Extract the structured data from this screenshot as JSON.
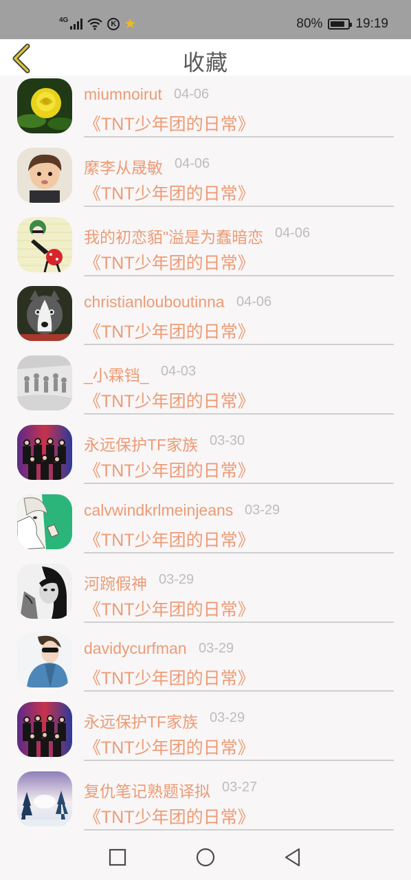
{
  "status_bar": {
    "network_tag": "4G",
    "battery_percent": "80%",
    "battery_level": 0.8,
    "time": "19:19",
    "icons": [
      "signal-icon",
      "wifi-icon",
      "k-app-icon",
      "star-app-icon",
      "battery-icon"
    ]
  },
  "header": {
    "title": "收藏",
    "back_icon": "chevron-left-icon",
    "accent_color": "#d9c23a"
  },
  "items": [
    {
      "name": "miumnoirut",
      "date": "04-06",
      "title": "《TNT少年团的日常》",
      "avatar": "yellow-rose"
    },
    {
      "name": "縻李从晟敏",
      "date": "04-06",
      "title": "《TNT少年团的日常》",
      "avatar": "child-photo"
    },
    {
      "name": "我的初恋貊\"溢是为蠢暗恋",
      "date": "04-06",
      "title": "《TNT少年团的日常》",
      "avatar": "cartoon-girl"
    },
    {
      "name": "christianlouboutinna",
      "date": "04-06",
      "title": "《TNT少年团的日常》",
      "avatar": "husky-dog"
    },
    {
      "name": "_小霖铛_",
      "date": "04-03",
      "title": "《TNT少年团的日常》",
      "avatar": "group-sketch"
    },
    {
      "name": "永远保护TF家族",
      "date": "03-30",
      "title": "《TNT少年团的日常》",
      "avatar": "group-photo"
    },
    {
      "name": "calvwindkrlmeinjeans",
      "date": "03-29",
      "title": "《TNT少年团的日常》",
      "avatar": "anime-girl"
    },
    {
      "name": "河踠假神",
      "date": "03-29",
      "title": "《TNT少年团的日常》",
      "avatar": "bw-portrait"
    },
    {
      "name": "davidycurfman",
      "date": "03-29",
      "title": "《TNT少年团的日常》",
      "avatar": "sunglasses-boy"
    },
    {
      "name": "永远保护TF家族",
      "date": "03-29",
      "title": "《TNT少年团的日常》",
      "avatar": "group-photo"
    },
    {
      "name": "复仇笔记熟题译拟",
      "date": "03-27",
      "title": "《TNT少年团的日常》",
      "avatar": "winter-trees"
    }
  ],
  "nav_bar": {
    "buttons": [
      "recent-apps-icon",
      "home-icon",
      "back-triangle-icon"
    ]
  },
  "colors": {
    "accent_text": "#ec9b74",
    "date_text": "#bdbdbd",
    "divider": "#cfcfcf",
    "background": "#f8f6f7"
  }
}
